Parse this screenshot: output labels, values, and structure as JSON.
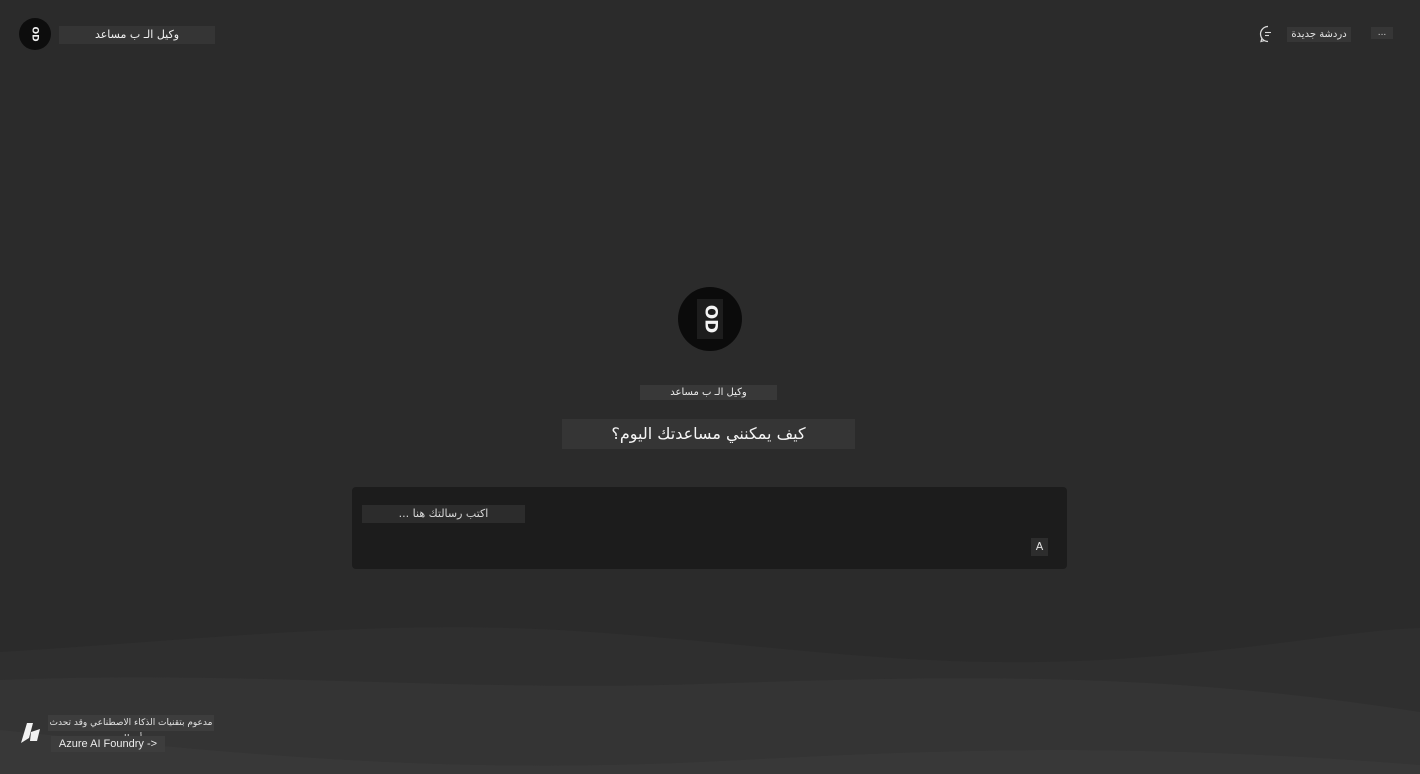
{
  "header": {
    "avatar_initials": "OD",
    "agent_name": "وكيل الـ ب مساعد",
    "new_chat_label": "دردشة جديدة",
    "more_label": "..."
  },
  "main": {
    "avatar_initials": "OD",
    "agent_name": "وكيل الـ ب مساعد",
    "greeting": "كيف يمكنني مساعدتك اليوم؟"
  },
  "composer": {
    "placeholder": "اكتب رسالتك هنا ...",
    "attach_label": "A"
  },
  "footer": {
    "disclaimer": "مدعوم بتقنيات الذكاء الاصطناعي وقد تحدث أخطاء",
    "foundry_link": "Azure AI Foundry ->"
  },
  "colors": {
    "background": "#2b2b2b",
    "composer_bg": "#1c1c1c",
    "avatar_bg": "#0b0b0b"
  }
}
